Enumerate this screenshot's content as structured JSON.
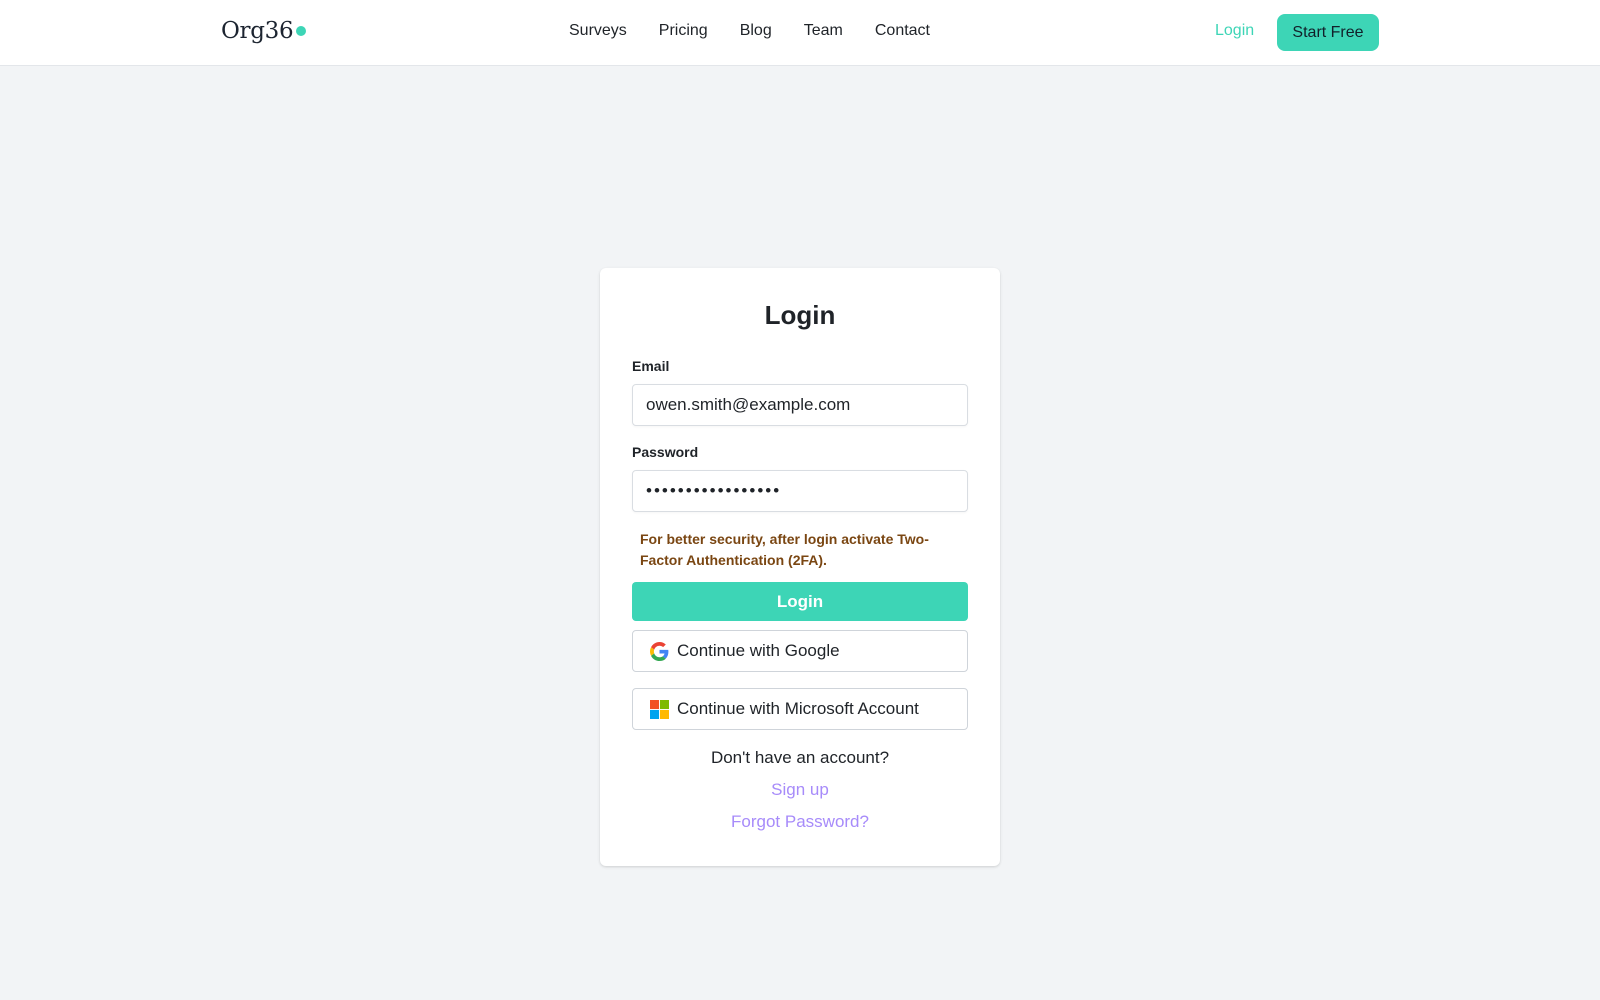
{
  "header": {
    "logo": "Org36",
    "nav": [
      "Surveys",
      "Pricing",
      "Blog",
      "Team",
      "Contact"
    ],
    "login_label": "Login",
    "start_free_label": "Start Free"
  },
  "login_form": {
    "title": "Login",
    "email_label": "Email",
    "email_value": "owen.smith@example.com",
    "password_label": "Password",
    "password_value": "•••••••••••••••••",
    "security_notice": "For better security, after login activate Two-Factor Authentication (2FA).",
    "login_button": "Login",
    "google_button": "Continue with Google",
    "microsoft_button": "Continue with Microsoft Account",
    "no_account_text": "Don't have an account?",
    "signup_link": "Sign up",
    "forgot_link": "Forgot Password?"
  },
  "icons": {
    "google": "google-g-logo",
    "microsoft": "microsoft-logo"
  },
  "colors": {
    "accent": "#3dd5b6",
    "link": "#a78bfa",
    "notice": "#7a4612",
    "background": "#f2f4f6"
  }
}
